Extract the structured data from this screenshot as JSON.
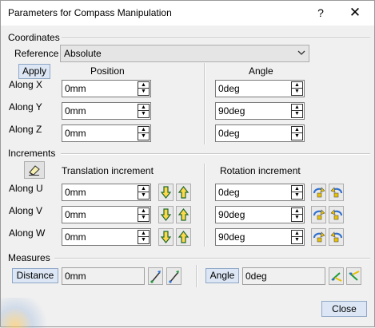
{
  "window": {
    "title": "Parameters for Compass Manipulation",
    "help_glyph": "?",
    "close_glyph": "✕"
  },
  "coordinates": {
    "section_title": "Coordinates",
    "reference_label": "Reference",
    "reference_value": "Absolute",
    "apply_label": "Apply",
    "position_header": "Position",
    "angle_header": "Angle",
    "rows": [
      {
        "label": "Along X",
        "position": "0mm",
        "angle": "0deg"
      },
      {
        "label": "Along Y",
        "position": "0mm",
        "angle": "90deg"
      },
      {
        "label": "Along Z",
        "position": "0mm",
        "angle": "0deg"
      }
    ]
  },
  "increments": {
    "section_title": "Increments",
    "translation_header": "Translation increment",
    "rotation_header": "Rotation increment",
    "rows": [
      {
        "label": "Along U",
        "translation": "0mm",
        "rotation": "0deg"
      },
      {
        "label": "Along V",
        "translation": "0mm",
        "rotation": "90deg"
      },
      {
        "label": "Along W",
        "translation": "0mm",
        "rotation": "90deg"
      }
    ]
  },
  "measures": {
    "section_title": "Measures",
    "distance_label": "Distance",
    "distance_value": "0mm",
    "angle_label": "Angle",
    "angle_value": "0deg"
  },
  "footer": {
    "close_label": "Close"
  },
  "icons": {
    "eraser": "eraser-icon",
    "translate_down": "arrow-down-icon",
    "translate_up": "arrow-up-icon",
    "rotate_cw": "rotate-cw-icon",
    "rotate_ccw": "rotate-ccw-icon",
    "measure_distance": "measure-distance-icon",
    "measure_angle": "measure-angle-icon"
  },
  "colors": {
    "arrow_green": "#1f9a3a",
    "rotate_yellow": "#e8c000",
    "rotate_blue": "#2f6fd0"
  }
}
